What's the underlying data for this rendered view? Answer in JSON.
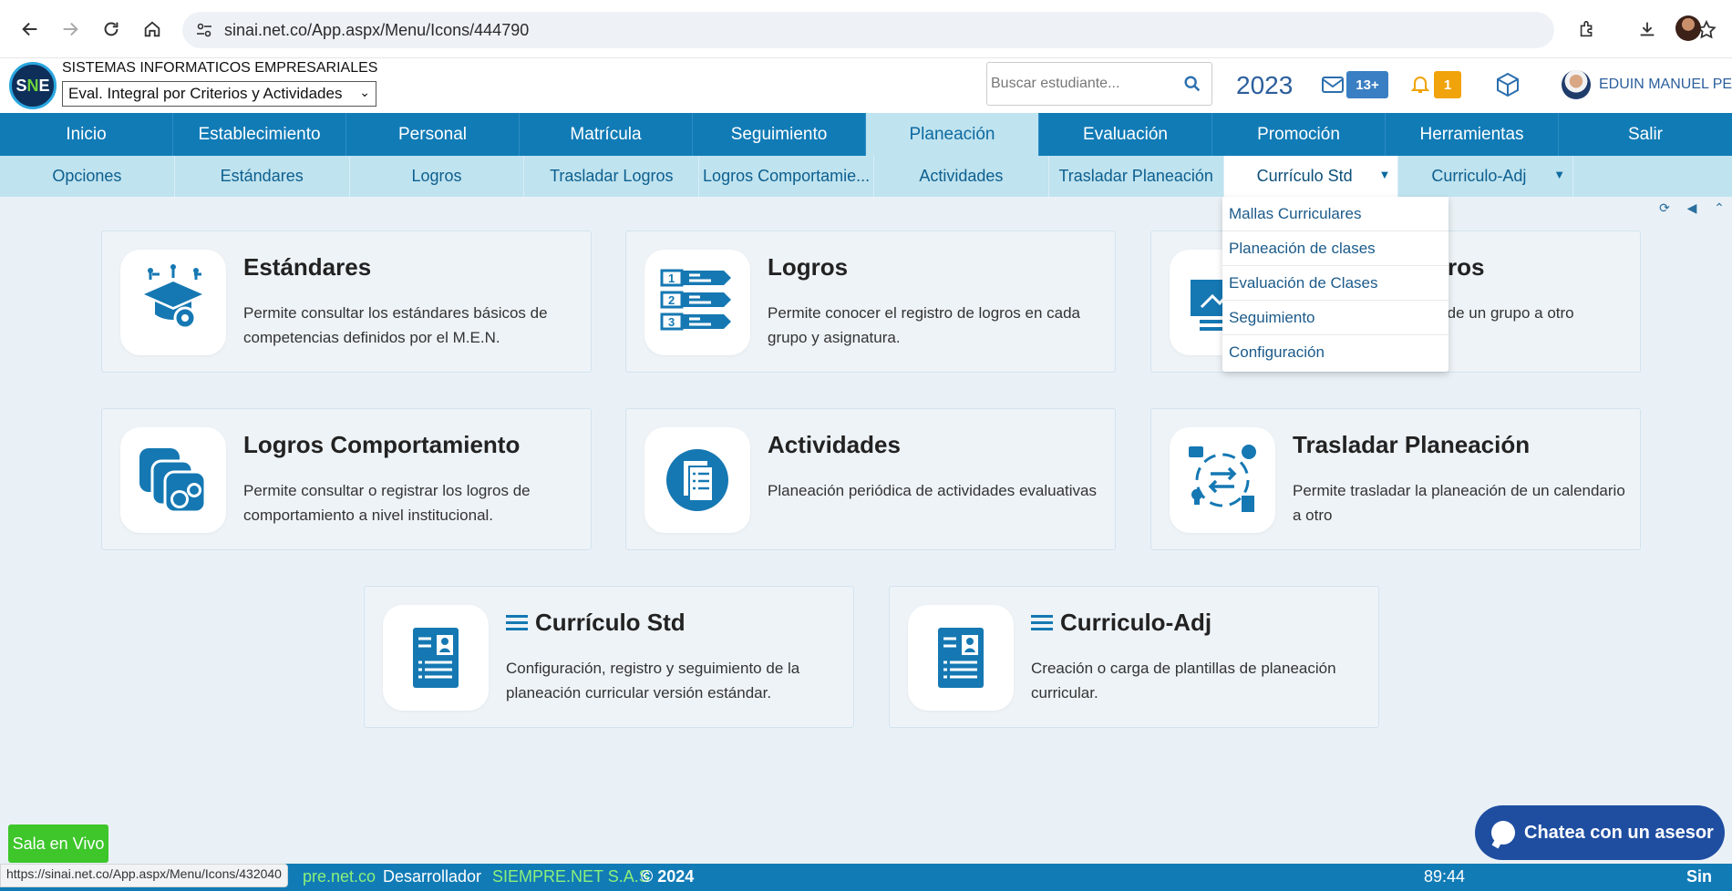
{
  "browser": {
    "url": "sinai.net.co/App.aspx/Menu/Icons/444790",
    "status_url": "https://sinai.net.co/App.aspx/Menu/Icons/432040"
  },
  "header": {
    "company": "SISTEMAS INFORMATICOS EMPRESARIALES",
    "app_select_value": "Eval. Integral por Criterios y Actividades",
    "search_placeholder": "Buscar estudiante...",
    "year": "2023",
    "mail_badge": "13+",
    "notif_badge": "1",
    "user_name": "EDUIN MANUEL PE..."
  },
  "nav": {
    "main": [
      "Inicio",
      "Establecimiento",
      "Personal",
      "Matrícula",
      "Seguimiento",
      "Planeación",
      "Evaluación",
      "Promoción",
      "Herramientas",
      "Salir"
    ],
    "active_main": "Planeación",
    "sub": [
      "Opciones",
      "Estándares",
      "Logros",
      "Trasladar Logros",
      "Logros Comportamie...",
      "Actividades",
      "Trasladar Planeación",
      "Currículo Std",
      "Curriculo-Adj"
    ]
  },
  "dropdown": {
    "items": [
      "Mallas Curriculares",
      "Planeación de clases",
      "Evaluación de Clases",
      "Seguimiento",
      "Configuración"
    ]
  },
  "cards": [
    {
      "title": "Estándares",
      "desc": "Permite consultar los estándares básicos de competencias definidos por el M.E.N.",
      "icon": "graduation-cap-gear-icon"
    },
    {
      "title": "Logros",
      "desc": "Permite conocer el registro de logros en cada grupo y asignatura.",
      "icon": "numbered-list-icon"
    },
    {
      "title": "ros",
      "desc": "os de un grupo a otro",
      "icon": "presentation-chart-icon"
    },
    {
      "title": "Logros Comportamiento",
      "desc": "Permite consultar o registrar los logros de comportamiento a nivel institucional.",
      "icon": "behavior-faces-icon"
    },
    {
      "title": "Actividades",
      "desc": "Planeación periódica de actividades evaluativas",
      "icon": "activity-document-icon"
    },
    {
      "title": "Trasladar Planeación",
      "desc": "Permite trasladar la planeación de un calendario a otro",
      "icon": "transfer-cycle-icon"
    },
    {
      "title": "Currículo Std",
      "desc": "Configuración, registro y seguimiento de la planeación curricular versión estándar.",
      "icon": "curriculum-profile-icon"
    },
    {
      "title": "Curriculo-Adj",
      "desc": "Creación o carga de plantillas de planeación curricular.",
      "icon": "curriculum-profile-icon"
    }
  ],
  "bottom": {
    "live_button": "Sala en Vivo",
    "chat_button": "Chatea con un asesor"
  },
  "footer": {
    "site": "pre.net.co",
    "dev_label": "Desarrollador",
    "dev_company": "SIEMPRE.NET S.A.S",
    "copyright": "© 2024",
    "timer": "89:44",
    "brand": "Sin"
  },
  "colors": {
    "nav_blue": "#117bb6",
    "sub_nav": "#bfe3ef",
    "accent_green": "#3ec62b",
    "badge_orange": "#f0a30a"
  }
}
